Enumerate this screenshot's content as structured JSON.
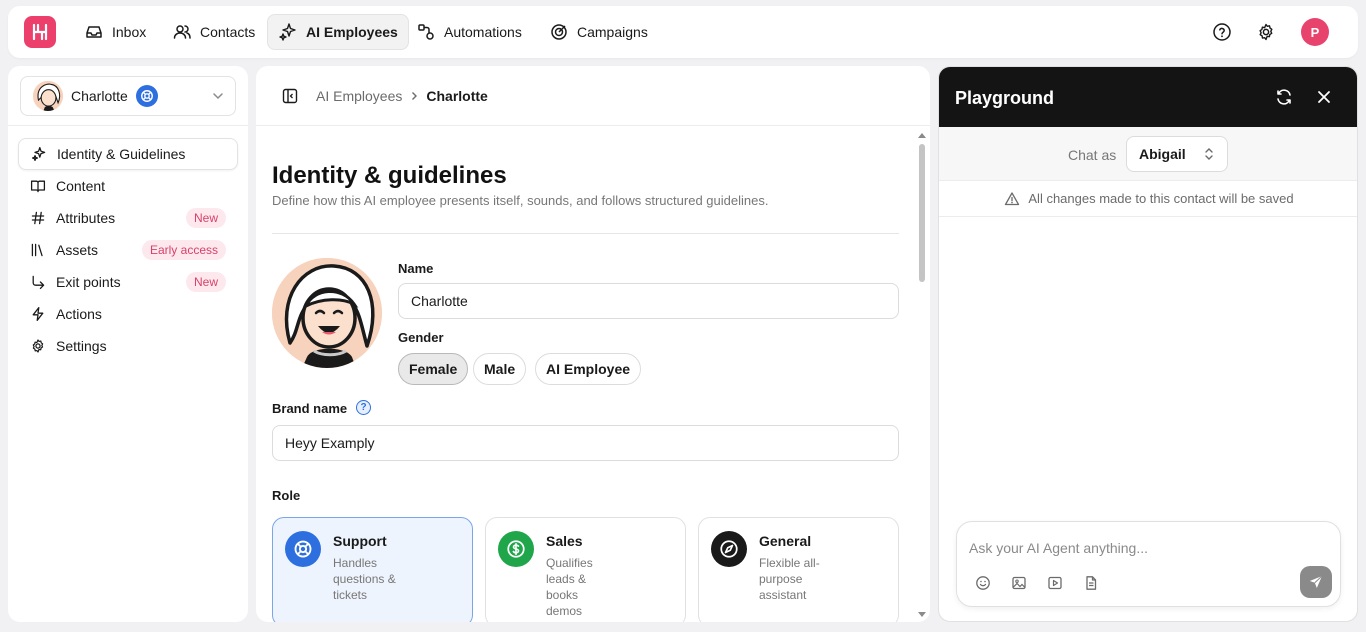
{
  "topnav": {
    "tabs": [
      {
        "label": "Inbox",
        "icon": "inbox-icon"
      },
      {
        "label": "Contacts",
        "icon": "users-icon"
      },
      {
        "label": "AI Employees",
        "icon": "sparkles-icon",
        "active": true
      },
      {
        "label": "Automations",
        "icon": "automations-icon"
      },
      {
        "label": "Campaigns",
        "icon": "target-icon"
      }
    ],
    "avatar_initial": "P"
  },
  "sidebar": {
    "agent_name": "Charlotte",
    "items": [
      {
        "label": "Identity & Guidelines",
        "icon": "sparkles-icon",
        "active": true
      },
      {
        "label": "Content",
        "icon": "book-icon"
      },
      {
        "label": "Attributes",
        "icon": "hash-icon",
        "badge": "New"
      },
      {
        "label": "Assets",
        "icon": "library-icon",
        "badge": "Early access"
      },
      {
        "label": "Exit points",
        "icon": "exit-arrow-icon",
        "badge": "New"
      },
      {
        "label": "Actions",
        "icon": "bolt-icon"
      },
      {
        "label": "Settings",
        "icon": "gear-icon"
      }
    ]
  },
  "main": {
    "breadcrumb": {
      "parent": "AI Employees",
      "current": "Charlotte"
    },
    "title": "Identity & guidelines",
    "subtitle": "Define how this AI employee presents itself, sounds, and follows structured guidelines.",
    "name_label": "Name",
    "name_value": "Charlotte",
    "gender_label": "Gender",
    "gender_options": [
      "Female",
      "Male",
      "AI Employee"
    ],
    "gender_selected": "Female",
    "brand_label": "Brand name",
    "brand_help": "?",
    "brand_value": "Heyy Examply",
    "role_label": "Role",
    "roles": [
      {
        "title": "Support",
        "desc": "Handles questions & tickets",
        "color": "#2e6fe0",
        "selected": true
      },
      {
        "title": "Sales",
        "desc": "Qualifies leads & books demos",
        "color": "#1fa64a"
      },
      {
        "title": "General",
        "desc": "Flexible all-purpose assistant",
        "color": "#1a1a1a"
      }
    ]
  },
  "playground": {
    "title": "Playground",
    "chat_as_label": "Chat as",
    "chat_as_value": "Abigail",
    "notice": "All changes made to this contact will be saved",
    "placeholder": "Ask your AI Agent anything..."
  },
  "colors": {
    "brand": "#ec3f6b",
    "accent": "#2e6fe0"
  }
}
